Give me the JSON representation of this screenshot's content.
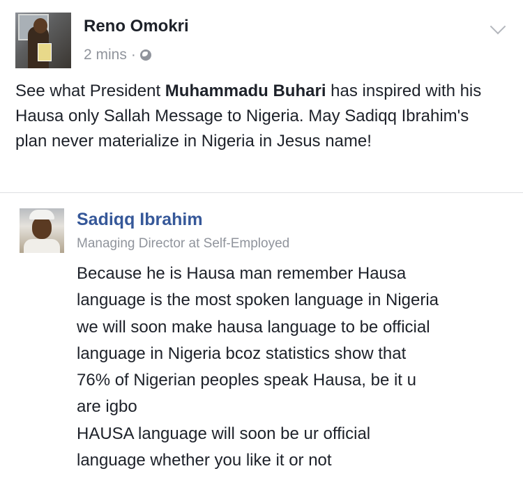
{
  "post": {
    "author": "Reno Omokri",
    "time": "2 mins",
    "separator": "·",
    "visibility_icon": "globe-icon",
    "text_before": "See what President ",
    "text_bold": "Muhammadu Buhari",
    "text_after": " has inspired with his Hausa only Sallah Message to Nigeria. May Sadiqq Ibrahim's plan never materialize in Nigeria in Jesus name!"
  },
  "shared": {
    "name": "Sadiqq Ibrahim",
    "role": "Managing Director at Self-Employed",
    "lines": [
      "Because he is Hausa man remember Hausa",
      "language is the most spoken language in Nigeria",
      "we will soon make hausa language to be official",
      "language in Nigeria bcoz statistics show that",
      "76% of Nigerian peoples speak Hausa, be it u",
      "are igbo",
      "HAUSA language will soon be ur official",
      "language whether you like it or not"
    ]
  },
  "colors": {
    "name_link": "#365899",
    "meta_gray": "#90949c",
    "text": "#1d2129"
  }
}
